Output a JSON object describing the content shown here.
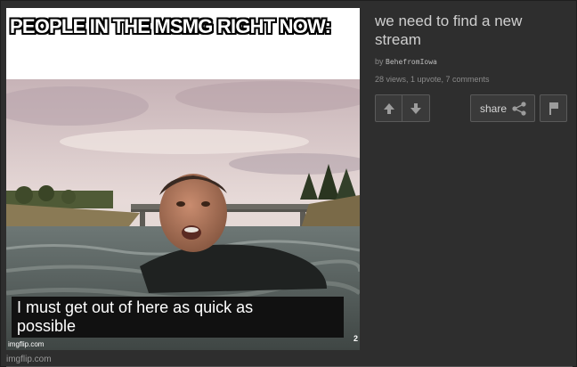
{
  "meme": {
    "top_text": "PEOPLE IN THE MSMG RIGHT NOW:",
    "subtitle_line1": "I must get out of here as quick as",
    "subtitle_line2": "possible",
    "watermark": "imgflip.com",
    "corner_mark": "2"
  },
  "site_mark": "imgflip.com",
  "post": {
    "title": "we need to find a new stream",
    "by_prefix": "by",
    "author": "BehefromIowa",
    "stats": "28 views, 1 upvote, 7 comments"
  },
  "actions": {
    "share_label": "share"
  },
  "icons": {
    "upvote": "arrow-up-icon",
    "downvote": "arrow-down-icon",
    "share": "share-icon",
    "flag": "flag-icon"
  },
  "colors": {
    "background": "#2e2e2e",
    "button_bg": "#3a3a3a",
    "button_border": "#5a5a5a",
    "title_text": "#cfcfcf"
  }
}
